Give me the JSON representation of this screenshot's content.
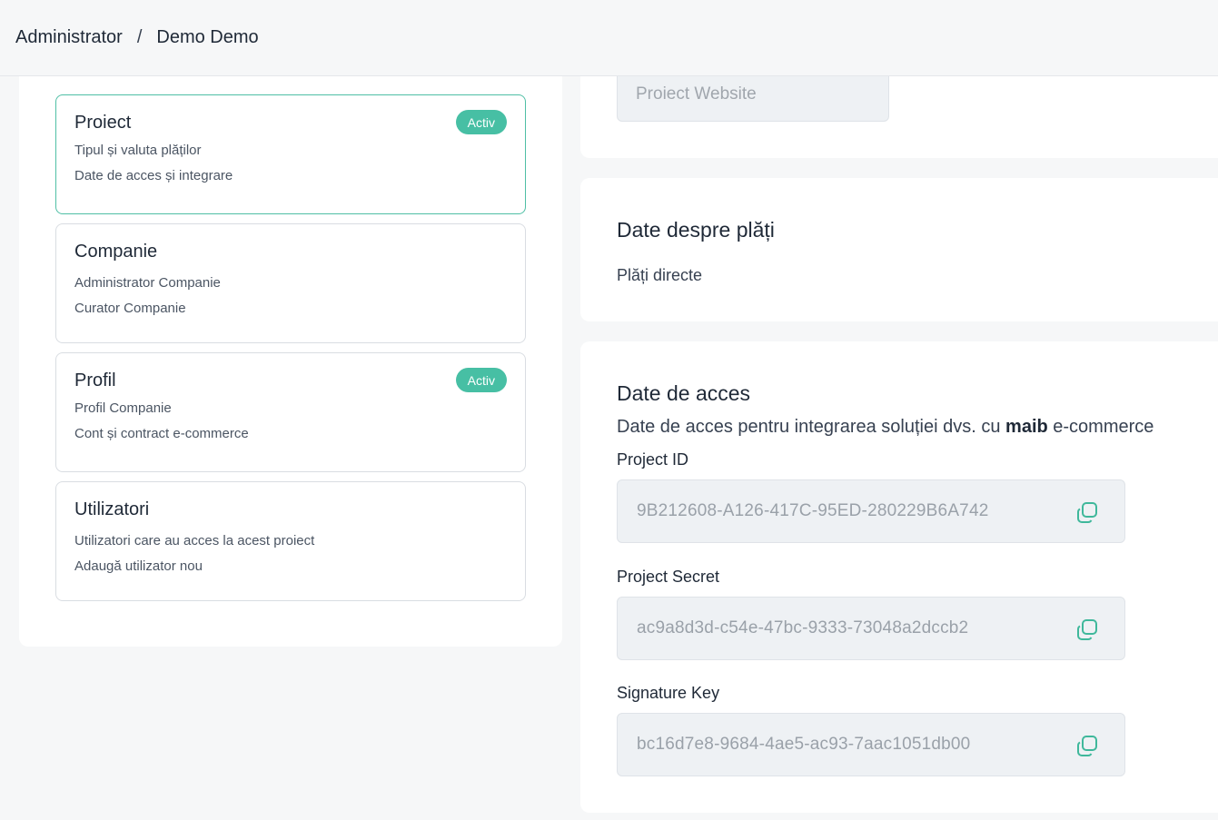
{
  "breadcrumb": {
    "root": "Administrator",
    "separator": "/",
    "current": "Demo Demo"
  },
  "nav_cards": [
    {
      "title": "Proiect",
      "badge": "Activ",
      "lines": [
        "Tipul și valuta plăților",
        "Date de acces și integrare"
      ]
    },
    {
      "title": "Companie",
      "badge": "",
      "lines": [
        "Administrator Companie",
        "Curator Companie"
      ]
    },
    {
      "title": "Profil",
      "badge": "Activ",
      "lines": [
        "Profil Companie",
        "Cont și contract e-commerce"
      ]
    },
    {
      "title": "Utilizatori",
      "badge": "",
      "lines": [
        "Utilizatori care au acces la acest proiect",
        "Adaugă utilizator nou"
      ]
    }
  ],
  "website": {
    "placeholder": "Proiect Website"
  },
  "payments": {
    "title": "Date despre plăți",
    "value": "Plăți directe"
  },
  "access": {
    "title": "Date de acces",
    "subtitle_before": "Date de acces pentru integrarea soluției dvs. cu ",
    "subtitle_brand": "maib",
    "subtitle_after": " e-commerce",
    "fields": [
      {
        "label": "Project ID",
        "value": "9B212608-A126-417C-95ED-280229B6A742",
        "icon": "copy-icon"
      },
      {
        "label": "Project Secret",
        "value": "ac9a8d3d-c54e-47bc-9333-73048a2dccb2",
        "icon": "copy-icon"
      },
      {
        "label": "Signature Key",
        "value": "bc16d7e8-9684-4ae5-ac93-7aac1051db00",
        "icon": "copy-icon"
      }
    ]
  },
  "colors": {
    "accent": "#47bfa4",
    "selected_border": "#4fbfa5",
    "field_bg": "#eef1f4"
  }
}
